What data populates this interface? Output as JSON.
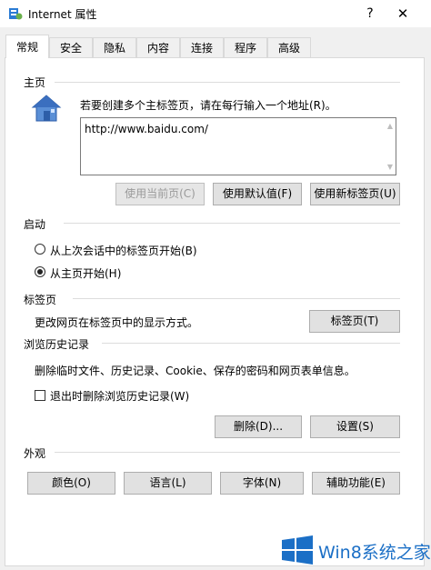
{
  "window": {
    "title": "Internet 属性",
    "help": "?",
    "close": "✕"
  },
  "tabs": [
    "常规",
    "安全",
    "隐私",
    "内容",
    "连接",
    "程序",
    "高级"
  ],
  "home": {
    "label": "主页",
    "description": "若要创建多个主标签页，请在每行输入一个地址(R)。",
    "url": "http://www.baidu.com/",
    "btn_current": "使用当前页(C)",
    "btn_default": "使用默认值(F)",
    "btn_newtab": "使用新标签页(U)"
  },
  "startup": {
    "label": "启动",
    "option1": "从上次会话中的标签页开始(B)",
    "option2": "从主页开始(H)",
    "selected": 2
  },
  "tabs_section": {
    "label": "标签页",
    "description": "更改网页在标签页中的显示方式。",
    "button": "标签页(T)"
  },
  "history": {
    "label": "浏览历史记录",
    "description": "删除临时文件、历史记录、Cookie、保存的密码和网页表单信息。",
    "checkbox": "退出时删除浏览历史记录(W)",
    "btn_delete": "删除(D)...",
    "btn_settings": "设置(S)"
  },
  "appearance": {
    "label": "外观",
    "btn_colors": "颜色(O)",
    "btn_languages": "语言(L)",
    "btn_fonts": "字体(N)",
    "btn_accessibility": "辅助功能(E)"
  },
  "watermark": {
    "text": "Win8系统之家"
  },
  "colors": {
    "accent": "#1b6fc6",
    "tab_border": "#d9d9d9",
    "button_bg": "#e1e1e1"
  }
}
